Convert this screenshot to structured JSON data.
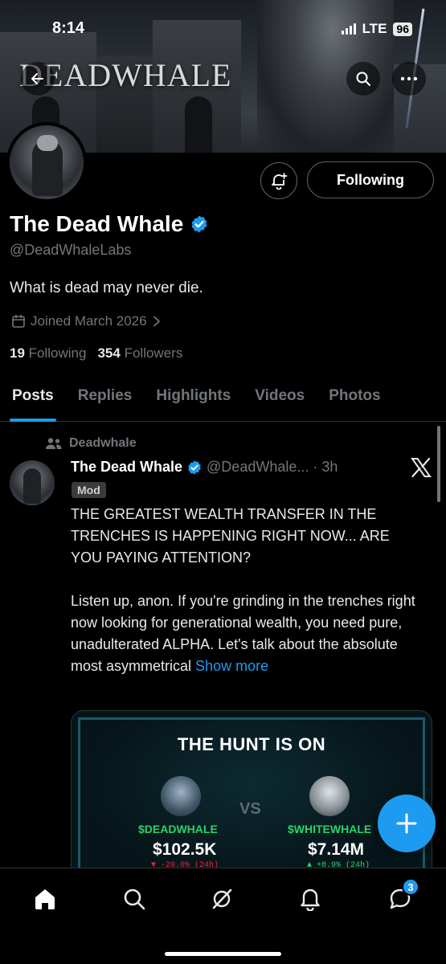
{
  "status_bar": {
    "time": "8:14",
    "network": "LTE",
    "battery": "96"
  },
  "banner": {
    "brand_text": "DEADWHALE"
  },
  "profile": {
    "display_name": "The Dead Whale",
    "handle": "@DeadWhaleLabs",
    "bio": "What is dead may never die.",
    "joined": "Joined March 2026",
    "following_count": "19",
    "following_label": "Following",
    "followers_count": "354",
    "followers_label": "Followers",
    "following_button": "Following"
  },
  "tabs": [
    "Posts",
    "Replies",
    "Highlights",
    "Videos",
    "Photos"
  ],
  "active_tab": "Posts",
  "post": {
    "community": "Deadwhale",
    "author_name": "The Dead Whale",
    "author_handle": "@DeadWhale...",
    "separator": "·",
    "time": "3h",
    "badge": "Mod",
    "paragraph_1": "THE GREATEST WEALTH TRANSFER IN THE TRENCHES IS HAPPENING RIGHT NOW... ARE YOU PAYING ATTENTION?",
    "paragraph_2": "Listen up, anon. If you're grinding in the trenches right now looking for generational wealth, you need pure, unadulterated ALPHA. Let's talk about the absolute most asymmetrical",
    "show_more": "Show more",
    "media": {
      "title": "THE HUNT IS ON",
      "vs": "VS",
      "left_tag": "$DEADWHALE",
      "left_price": "$102.5K",
      "left_change": "▼ -20.0% (24h)",
      "right_tag": "$WHITEWHALE",
      "right_price": "$7.14M",
      "right_change": "▲ +8.9% (24h)"
    }
  },
  "bottom_nav": {
    "messages_badge": "3"
  },
  "colors": {
    "accent": "#1d9bf0",
    "muted": "#71767b",
    "up": "#2bd26a",
    "down": "#f4212e"
  }
}
